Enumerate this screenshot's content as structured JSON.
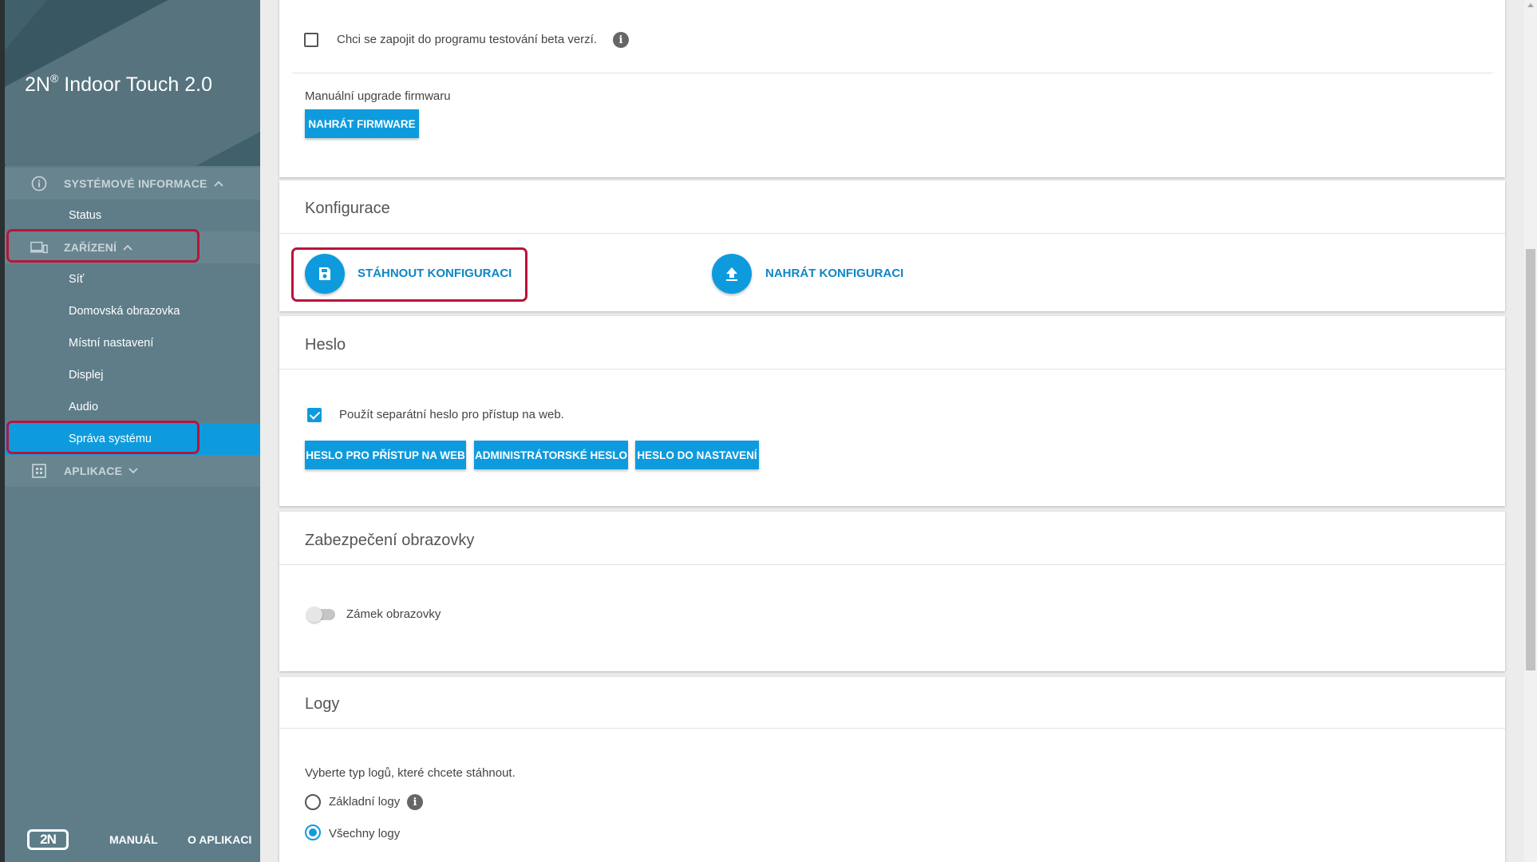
{
  "app": {
    "title": "2N",
    "title_sup": "®",
    "title_rest": " Indoor Touch 2.0"
  },
  "sidebar": {
    "sections": [
      {
        "label": "SYSTÉMOVÉ INFORMACE",
        "icon": "info-icon",
        "expanded": true
      },
      {
        "label": "ZAŘÍZENÍ",
        "icon": "devices-icon",
        "expanded": true
      },
      {
        "label": "APLIKACE",
        "icon": "apps-icon",
        "expanded": false
      }
    ],
    "items": [
      {
        "label": "Status"
      },
      {
        "label": "Síť"
      },
      {
        "label": "Domovská obrazovka"
      },
      {
        "label": "Místní nastavení"
      },
      {
        "label": "Displej"
      },
      {
        "label": "Audio"
      },
      {
        "label": "Správa systému",
        "active": true
      }
    ],
    "footer": {
      "logo": "2N",
      "manual": "MANUÁL",
      "about": "O APLIKACI"
    }
  },
  "firmware": {
    "beta_label": "Chci se zapojit do programu testování beta verzí.",
    "beta_checked": false,
    "manual_upgrade_label": "Manuální upgrade firmwaru",
    "upload_button": "NAHRÁT FIRMWARE"
  },
  "configuration": {
    "title": "Konfigurace",
    "download_label": "STÁHNOUT KONFIGURACI",
    "upload_label": "NAHRÁT KONFIGURACI"
  },
  "password": {
    "title": "Heslo",
    "separate_label": "Použít separátní heslo pro přístup na web.",
    "separate_checked": true,
    "buttons": [
      "HESLO PRO PŘÍSTUP NA WEB",
      "ADMINISTRÁTORSKÉ HESLO",
      "HESLO DO NASTAVENÍ"
    ]
  },
  "screen_security": {
    "title": "Zabezpečení obrazovky",
    "lock_label": "Zámek obrazovky",
    "lock_enabled": false
  },
  "logs": {
    "title": "Logy",
    "prompt": "Vyberte typ logů, které chcete stáhnout.",
    "options": [
      {
        "label": "Základní logy",
        "selected": false
      },
      {
        "label": "Všechny logy",
        "selected": true
      }
    ]
  },
  "colors": {
    "accent": "#0e9bde",
    "sidebar": "#5e7d89",
    "highlight": "#b8143a"
  }
}
